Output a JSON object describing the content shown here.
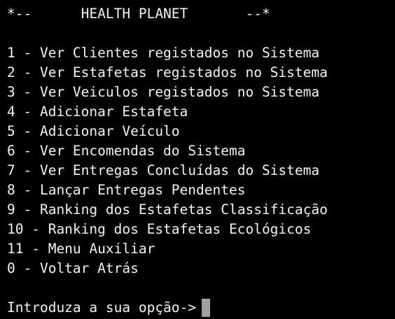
{
  "header": {
    "title_line": "*--      HEALTH PLANET       --*"
  },
  "menu": {
    "items": [
      "1 - Ver Clientes registados no Sistema",
      "2 - Ver Estafetas registados no Sistema",
      "3 - Ver Veiculos registados no Sistema",
      "4 - Adicionar Estafeta",
      "5 - Adicionar Veículo",
      "6 - Ver Encomendas do Sistema",
      "7 - Ver Entregas Concluídas do Sistema",
      "8 - Lançar Entregas Pendentes",
      "9 - Ranking dos Estafetas Classificação",
      "10 - Ranking dos Estafetas Ecológicos",
      "11 - Menu Auxiliar",
      "0 - Voltar Atrás"
    ]
  },
  "prompt": {
    "text": "Introduza a sua opção->",
    "input_value": ""
  },
  "colors": {
    "background": "#000000",
    "text": "#f2f2f2",
    "cursor": "#a0a0a0"
  }
}
